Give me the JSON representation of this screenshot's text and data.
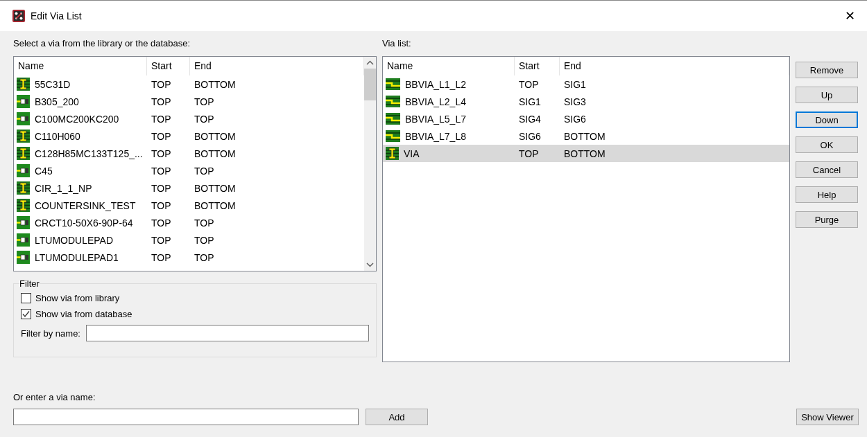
{
  "window": {
    "title": "Edit Via List",
    "close": "✕"
  },
  "library": {
    "label": "Select a via from the library or the database:",
    "columns": [
      "Name",
      "Start",
      "End"
    ],
    "rows": [
      {
        "name": "55C31D",
        "start": "TOP",
        "end": "BOTTOM",
        "kind": "through",
        "selected": false
      },
      {
        "name": "B305_200",
        "start": "TOP",
        "end": "TOP",
        "kind": "pad",
        "selected": false
      },
      {
        "name": "C100MC200KC200",
        "start": "TOP",
        "end": "TOP",
        "kind": "pad",
        "selected": false
      },
      {
        "name": "C110H060",
        "start": "TOP",
        "end": "BOTTOM",
        "kind": "through",
        "selected": false
      },
      {
        "name": "C128H85MC133T125_...",
        "start": "TOP",
        "end": "BOTTOM",
        "kind": "through",
        "selected": false
      },
      {
        "name": "C45",
        "start": "TOP",
        "end": "TOP",
        "kind": "pad",
        "selected": false
      },
      {
        "name": "CIR_1_1_NP",
        "start": "TOP",
        "end": "BOTTOM",
        "kind": "through",
        "selected": false
      },
      {
        "name": "COUNTERSINK_TEST",
        "start": "TOP",
        "end": "BOTTOM",
        "kind": "through",
        "selected": false
      },
      {
        "name": "CRCT10-50X6-90P-64",
        "start": "TOP",
        "end": "TOP",
        "kind": "pad",
        "selected": false
      },
      {
        "name": "LTUMODULEPAD",
        "start": "TOP",
        "end": "TOP",
        "kind": "pad",
        "selected": false
      },
      {
        "name": "LTUMODULEPAD1",
        "start": "TOP",
        "end": "TOP",
        "kind": "pad",
        "selected": false
      }
    ]
  },
  "filter": {
    "title": "Filter",
    "options": [
      {
        "label": "Show via from library",
        "checked": false
      },
      {
        "label": "Show via from database",
        "checked": true
      }
    ],
    "name_label": "Filter by name:"
  },
  "via_list": {
    "label": "Via list:",
    "columns": [
      "Name",
      "Start",
      "End"
    ],
    "rows": [
      {
        "name": "BBVIA_L1_L2",
        "start": "TOP",
        "end": "SIG1",
        "kind": "blind",
        "selected": false
      },
      {
        "name": "BBVIA_L2_L4",
        "start": "SIG1",
        "end": "SIG3",
        "kind": "blind",
        "selected": false
      },
      {
        "name": "BBVIA_L5_L7",
        "start": "SIG4",
        "end": "SIG6",
        "kind": "blind",
        "selected": false
      },
      {
        "name": "BBVIA_L7_L8",
        "start": "SIG6",
        "end": "BOTTOM",
        "kind": "blind",
        "selected": false
      },
      {
        "name": "VIA",
        "start": "TOP",
        "end": "BOTTOM",
        "kind": "through",
        "selected": true
      }
    ]
  },
  "buttons": [
    {
      "label": "Remove",
      "focused": false
    },
    {
      "label": "Up",
      "focused": false
    },
    {
      "label": "Down",
      "focused": true
    },
    {
      "label": "OK",
      "focused": false
    },
    {
      "label": "Cancel",
      "focused": false
    },
    {
      "label": "Help",
      "focused": false
    },
    {
      "label": "Purge",
      "focused": false
    }
  ],
  "entry": {
    "label": "Or enter a via name:",
    "add": "Add"
  },
  "viewer_button": "Show Viewer"
}
